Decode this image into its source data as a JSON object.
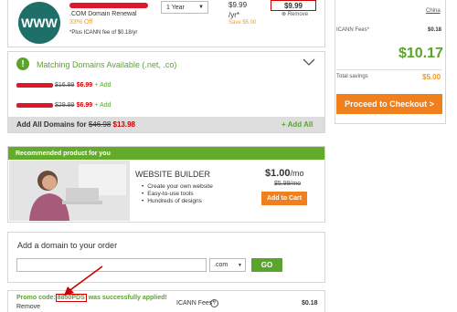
{
  "cart_item": {
    "logo_text": "WWW",
    "description": ".COM Domain Renewal",
    "discount": "33% Off",
    "icann_note": "*Plus ICANN fee of $0.18/yr",
    "term": "1 Year",
    "list_price": "$9.99",
    "list_price_unit": "/yr*",
    "savings": "Save $5.00",
    "final_price": "$9.99",
    "remove_label": "Remove"
  },
  "summary": {
    "country_link": "China",
    "icann_label": "ICANN Fees*",
    "icann_value": "$0.18",
    "total": "$10.17",
    "savings_label": "Total savings",
    "savings_value": "$5.00",
    "checkout_label": "Proceed to Checkout >"
  },
  "matching": {
    "title": "Matching Domains Available (.net, .co)",
    "suggestions": [
      {
        "old_price": "$16.99",
        "new_price": "$6.99",
        "add_label": "+ Add"
      },
      {
        "old_price": "$29.99",
        "new_price": "$6.99",
        "add_label": "+ Add"
      }
    ],
    "add_all_label": "Add All Domains for",
    "add_all_old": "$46.98",
    "add_all_new": "$13.98",
    "add_all_button": "+ Add All"
  },
  "recommended": {
    "header": "Recommended product for you",
    "title": "WEBSITE BUILDER",
    "features": [
      "Create your own website",
      "Easy-to-use tools",
      "Hundreds of designs"
    ],
    "price": "$1.00",
    "price_unit": "/mo",
    "old_price": "$5.99/mo",
    "add_label": "Add to Cart"
  },
  "add_domain": {
    "title": "Add a domain to your order",
    "input_value": "",
    "tld": ".com",
    "go_label": "GO"
  },
  "promo": {
    "prefix": "Promo code",
    "code": "8850PDS",
    "suffix": "was successfully applied!",
    "remove_label": "Remove",
    "icann_label": "ICANN Fees*",
    "help_glyph": "?",
    "icann_value": "$0.18"
  },
  "colors": {
    "accent_green": "#5aa42e",
    "accent_orange": "#f0801e",
    "alert_red": "#cc0000",
    "logo_teal": "#1f6f69"
  }
}
